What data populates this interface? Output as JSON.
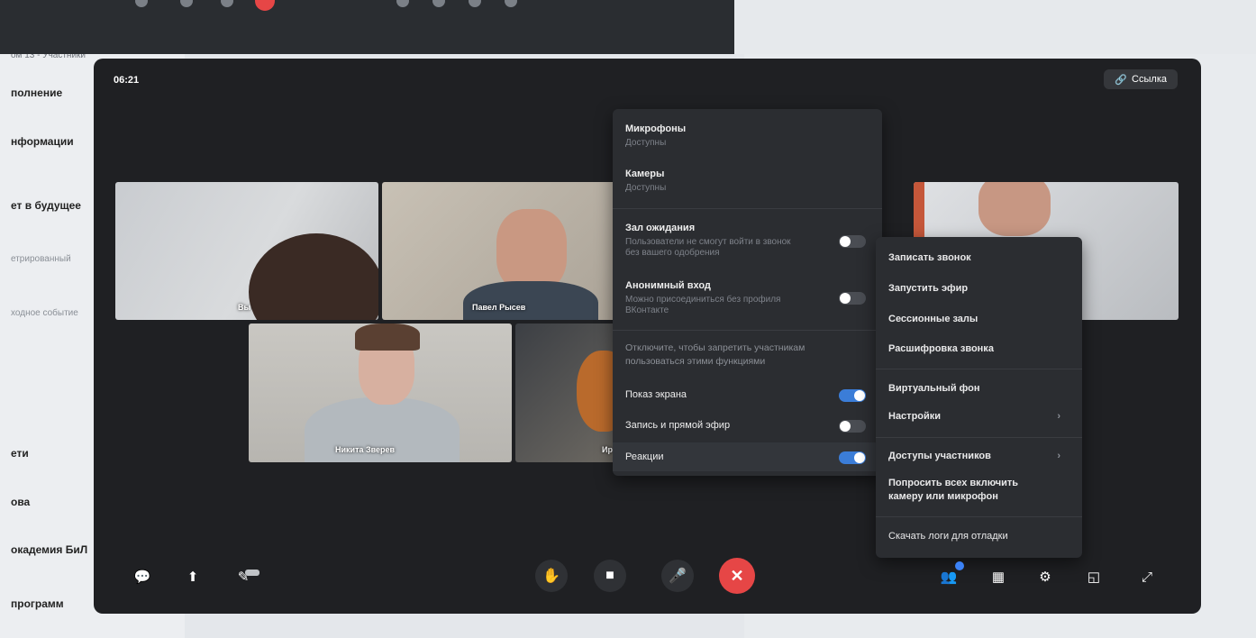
{
  "background": {
    "sidebar_items": [
      {
        "text": "ом 13 - Участники",
        "sub": false
      },
      {
        "text": "полнение",
        "sub": false
      },
      {
        "text": "нформации",
        "sub": false
      },
      {
        "text": "ет в будущее",
        "sub": false
      },
      {
        "text": "етрированный",
        "sub": true
      },
      {
        "text": "ходное событие",
        "sub": true
      },
      {
        "text": "ети",
        "sub": false
      },
      {
        "text": "ова",
        "sub": false
      },
      {
        "text": "окадемия БиЛ",
        "sub": false
      },
      {
        "text": "программ",
        "sub": false
      }
    ]
  },
  "call": {
    "timer": "06:21",
    "link_label": "Ссылка",
    "tiles": [
      {
        "name": "Вы"
      },
      {
        "name": "Павел Рысев"
      },
      {
        "name": "Никита Зверев"
      },
      {
        "name": "Ир"
      }
    ],
    "permissions_menu": {
      "microphones": {
        "title": "Микрофоны",
        "status": "Доступны"
      },
      "cameras": {
        "title": "Камеры",
        "status": "Доступны"
      },
      "waiting_room": {
        "title": "Зал ожидания",
        "desc": "Пользователи не смогут войти в звонок без вашего одобрения",
        "enabled": false
      },
      "anonymous": {
        "title": "Анонимный вход",
        "desc": "Можно присоединиться без профиля ВКонтакте",
        "enabled": false
      },
      "hint": "Отключите, чтобы запретить участникам пользоваться этими функциями",
      "screen_share": {
        "title": "Показ экрана",
        "enabled": true
      },
      "recording": {
        "title": "Запись и прямой эфир",
        "enabled": false
      },
      "reactions": {
        "title": "Реакции",
        "enabled": true
      }
    },
    "more_menu": {
      "items": [
        {
          "label": "Записать звонок"
        },
        {
          "label": "Запустить эфир"
        },
        {
          "label": "Сессионные залы"
        },
        {
          "label": "Расшифровка звонка"
        },
        {
          "label": "Виртуальный фон"
        },
        {
          "label": "Настройки"
        },
        {
          "label": "Доступы участников"
        },
        {
          "label": "Попросить всех включить камеру или микрофон"
        },
        {
          "label": "Скачать логи для отладки"
        }
      ]
    },
    "controls": {
      "left": [
        "chat-icon",
        "share-screen-icon",
        "draw-icon"
      ],
      "center": [
        "raise-hand-icon",
        "camera-icon",
        "microphone-icon",
        "end-call-icon"
      ],
      "right": [
        "participants-icon",
        "layout-icon",
        "settings-icon",
        "pip-icon",
        "fullscreen-icon"
      ]
    },
    "colors": {
      "accent": "#3b7dd8",
      "end_call": "#e64646",
      "panel": "#2b2d31",
      "window": "#1f2023"
    }
  }
}
